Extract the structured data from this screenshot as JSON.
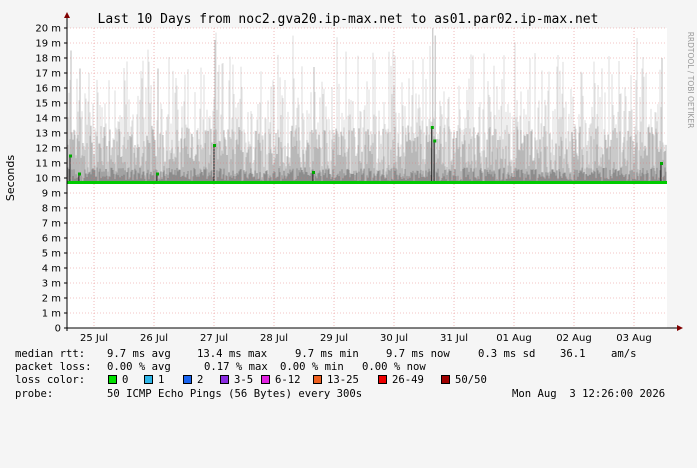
{
  "chart_data": {
    "type": "line",
    "title": "Last 10 Days from noc2.gva20.ip-max.net to as01.par02.ip-max.net",
    "ylabel": "Seconds",
    "xlabel": "",
    "ylim": [
      0,
      20
    ],
    "y_ticks": [
      0,
      1,
      2,
      3,
      4,
      5,
      6,
      7,
      8,
      9,
      10,
      11,
      12,
      13,
      14,
      15,
      16,
      17,
      18,
      19,
      20
    ],
    "y_tick_labels": [
      "0",
      "1 m",
      "2 m",
      "3 m",
      "4 m",
      "5 m",
      "6 m",
      "7 m",
      "8 m",
      "9 m",
      "10 m",
      "11 m",
      "12 m",
      "13 m",
      "14 m",
      "15 m",
      "16 m",
      "17 m",
      "18 m",
      "19 m",
      "20 m"
    ],
    "x_tick_labels": [
      "25 Jul",
      "26 Jul",
      "27 Jul",
      "28 Jul",
      "29 Jul",
      "30 Jul",
      "31 Jul",
      "01 Aug",
      "02 Aug",
      "03 Aug"
    ],
    "grid": true,
    "series": [
      {
        "name": "median rtt",
        "baseline_ms": 9.7,
        "color": "#00cc00"
      }
    ],
    "spikes_ms": [
      {
        "day": 0.05,
        "value": 11.5
      },
      {
        "day": 0.2,
        "value": 10.3
      },
      {
        "day": 1.5,
        "value": 10.3
      },
      {
        "day": 2.45,
        "value": 12.2
      },
      {
        "day": 4.1,
        "value": 10.4
      },
      {
        "day": 6.08,
        "value": 13.4
      },
      {
        "day": 6.12,
        "value": 12.5
      },
      {
        "day": 9.9,
        "value": 11.0
      }
    ],
    "smoke_max_ms": 20
  },
  "credit": "RRDTOOL / TOBI OETIKER",
  "stats": {
    "rtt_label": "median rtt:",
    "rtt_avg": "9.7 ms avg",
    "rtt_max": "13.4 ms max",
    "rtt_min": "9.7 ms min",
    "rtt_now": "9.7 ms now",
    "rtt_sd": "0.3 ms sd",
    "rtt_ams": "36.1",
    "rtt_ams_unit": "am/s",
    "loss_label": "packet loss:",
    "loss_avg": "0.00 % avg",
    "loss_max": "0.17 % max",
    "loss_min": "0.00 % min",
    "loss_now": "0.00 % now"
  },
  "loss_colors": {
    "label": "loss color:",
    "items": [
      {
        "label": "0",
        "color": "#00e000"
      },
      {
        "label": "1",
        "color": "#2fb6e8"
      },
      {
        "label": "2",
        "color": "#1a64f0"
      },
      {
        "label": "3-5",
        "color": "#8a2be2"
      },
      {
        "label": "6-12",
        "color": "#e020e0"
      },
      {
        "label": "13-25",
        "color": "#ee6020"
      },
      {
        "label": "26-49",
        "color": "#ee0000"
      },
      {
        "label": "50/50",
        "color": "#a00000"
      }
    ]
  },
  "probe": {
    "label": "probe:",
    "text": "50 ICMP Echo Pings (56 Bytes) every 300s",
    "timestamp": "Mon Aug  3 12:26:00 2026"
  }
}
